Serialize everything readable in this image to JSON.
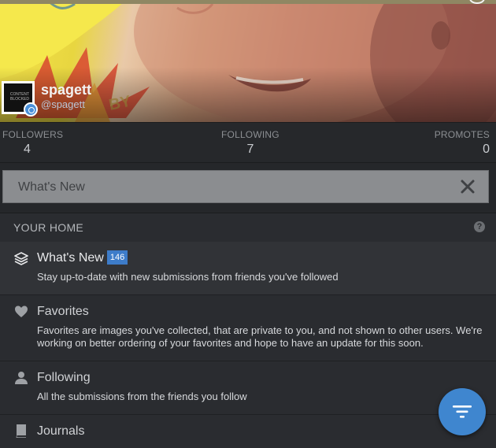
{
  "profile": {
    "display_name": "spagett",
    "handle": "@spagett",
    "avatar_text": "CONTENT BLOCKED"
  },
  "stats": {
    "followers_label": "FOLLOWERS",
    "followers_value": "4",
    "following_label": "FOLLOWING",
    "following_value": "7",
    "promotes_label": "PROMOTES",
    "promotes_value": "0"
  },
  "search": {
    "value": "What's New"
  },
  "section": {
    "title": "YOUR HOME",
    "help": "?"
  },
  "items": [
    {
      "icon": "layers-icon",
      "label": "What's New",
      "badge": "146",
      "description": "Stay up-to-date with new submissions from friends you've followed"
    },
    {
      "icon": "heart-icon",
      "label": "Favorites",
      "description": "Favorites are images you've collected, that are private to you, and not shown to other users. We're working on better ordering of your favorites and hope to have an update for this soon."
    },
    {
      "icon": "person-icon",
      "label": "Following",
      "description": "All the submissions from the friends you follow"
    },
    {
      "icon": "book-icon",
      "label": "Journals",
      "description": ""
    }
  ],
  "colors": {
    "accent": "#3f86cf",
    "badge": "#3d7cc9",
    "background": "#2a2c30"
  }
}
